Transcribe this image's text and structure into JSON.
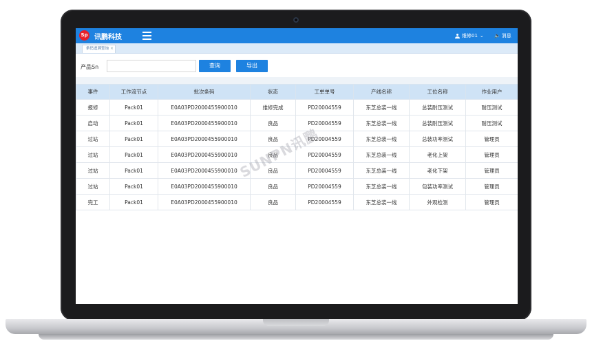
{
  "header": {
    "logo_text": "Sp",
    "brand": "讯鹏科技",
    "user": "维修01",
    "user_caret": "⌄",
    "message": "消息"
  },
  "tabbar": {
    "active_tab": "条码追溯查询",
    "close_glyph": "×"
  },
  "search": {
    "label": "产品Sn",
    "value": "",
    "query_button": "查询",
    "export_button": "导出"
  },
  "table": {
    "columns": [
      "事件",
      "工作流节点",
      "批次条码",
      "状态",
      "工单单号",
      "产线名称",
      "工位名称",
      "作业用户"
    ],
    "rows": [
      [
        "报修",
        "Pack01",
        "E0A03PD2000455900010",
        "维修完成",
        "PD20004559",
        "东芝总装一线",
        "总装耐压测试",
        "耐压测试"
      ],
      [
        "启动",
        "Pack01",
        "E0A03PD2000455900010",
        "良品",
        "PD20004559",
        "东芝总装一线",
        "总装耐压测试",
        "耐压测试"
      ],
      [
        "过站",
        "Pack01",
        "E0A03PD2000455900010",
        "良品",
        "PD20004559",
        "东芝总装一线",
        "总装功率测试",
        "管理员"
      ],
      [
        "过站",
        "Pack01",
        "E0A03PD2000455900010",
        "良品",
        "PD20004559",
        "东芝总装一线",
        "老化上架",
        "管理员"
      ],
      [
        "过站",
        "Pack01",
        "E0A03PD2000455900010",
        "良品",
        "PD20004559",
        "东芝总装一线",
        "老化下架",
        "管理员"
      ],
      [
        "过站",
        "Pack01",
        "E0A03PD2000455900010",
        "良品",
        "PD20004559",
        "东芝总装一线",
        "包装功率测试",
        "管理员"
      ],
      [
        "完工",
        "Pack01",
        "E0A03PD2000455900010",
        "良品",
        "PD20004559",
        "东芝总装一线",
        "外观检测",
        "管理员"
      ]
    ]
  },
  "watermark": "SUNPN讯鹏",
  "colors": {
    "primary": "#1e82e0",
    "header_row": "#cfe3f6",
    "logo": "#e8202a"
  }
}
